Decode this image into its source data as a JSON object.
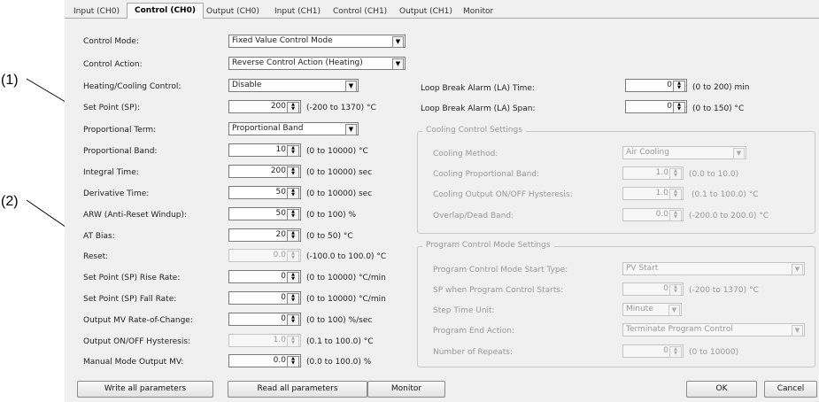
{
  "callouts": [
    "(1)",
    "(2)"
  ],
  "tabs": [
    "Input (CH0)",
    "Control (CH0)",
    "Output (CH0)",
    "Input (CH1)",
    "Control (CH1)",
    "Output (CH1)",
    "Monitor"
  ],
  "left": {
    "control_mode": {
      "label": "Control Mode:",
      "value": "Fixed Value Control Mode"
    },
    "control_action": {
      "label": "Control Action:",
      "value": "Reverse Control Action (Heating)"
    },
    "heating_cooling": {
      "label": "Heating/Cooling Control:",
      "value": "Disable"
    },
    "set_point": {
      "label": "Set Point (SP):",
      "value": "200",
      "range": "(-200 to 1370) °C"
    },
    "proportional_term": {
      "label": "Proportional Term:",
      "value": "Proportional Band"
    },
    "proportional_band": {
      "label": "Proportional Band:",
      "value": "10",
      "range": "(0 to 10000) °C"
    },
    "integral_time": {
      "label": "Integral Time:",
      "value": "200",
      "range": "(0 to 10000) sec"
    },
    "derivative_time": {
      "label": "Derivative Time:",
      "value": "50",
      "range": "(0 to 10000) sec"
    },
    "arw": {
      "label": "ARW (Anti-Reset Windup):",
      "value": "50",
      "range": "(0 to 100) %"
    },
    "at_bias": {
      "label": "AT Bias:",
      "value": "20",
      "range": "(0 to 50) °C"
    },
    "reset": {
      "label": "Reset:",
      "value": "0.0",
      "range": "(-100.0 to 100.0) °C"
    },
    "sp_rise": {
      "label": "Set Point (SP) Rise Rate:",
      "value": "0",
      "range": "(0 to 10000) °C/min"
    },
    "sp_fall": {
      "label": "Set Point (SP) Fall Rate:",
      "value": "0",
      "range": "(0 to 10000) °C/min"
    },
    "mv_rate": {
      "label": "Output MV Rate-of-Change:",
      "value": "0",
      "range": "(0 to 100) %/sec"
    },
    "onoff_hyst": {
      "label": "Output ON/OFF Hysteresis:",
      "value": "1.0",
      "range": "(0.1 to 100.0) °C"
    },
    "manual_mv": {
      "label": "Manual Mode Output MV:",
      "value": "0.0",
      "range": "(0.0 to 100.0) %"
    }
  },
  "right": {
    "la_time": {
      "label": "Loop Break Alarm (LA) Time:",
      "value": "0",
      "range": "(0 to 200) min"
    },
    "la_span": {
      "label": "Loop Break Alarm (LA) Span:",
      "value": "0",
      "range": "(0 to 150) °C"
    },
    "cooling": {
      "title": "Cooling Control Settings",
      "method": {
        "label": "Cooling Method:",
        "value": "Air Cooling"
      },
      "prop_band": {
        "label": "Cooling Proportional Band:",
        "value": "1.0",
        "range": "(0.0 to 10.0)"
      },
      "onoff_hyst": {
        "label": "Cooling Output ON/OFF Hysteresis:",
        "value": "1.0",
        "range": "(0.1 to 100.0) °C"
      },
      "overlap": {
        "label": "Overlap/Dead Band:",
        "value": "0.0",
        "range": "(-200.0 to 200.0) °C"
      }
    },
    "program": {
      "title": "Program Control Mode Settings",
      "start_type": {
        "label": "Program Control Mode Start Type:",
        "value": "PV Start"
      },
      "sp_start": {
        "label": "SP when Program Control Starts:",
        "value": "0",
        "range": "(-200 to 1370) °C"
      },
      "step_unit": {
        "label": "Step Time Unit:",
        "value": "Minute"
      },
      "end_action": {
        "label": "Program End Action:",
        "value": "Terminate Program Control"
      },
      "repeats": {
        "label": "Number of Repeats:",
        "value": "0",
        "range": "(0 to 10000)"
      }
    }
  },
  "buttons": {
    "write": "Write all parameters",
    "read": "Read all parameters",
    "monitor": "Monitor",
    "ok": "OK",
    "cancel": "Cancel"
  }
}
